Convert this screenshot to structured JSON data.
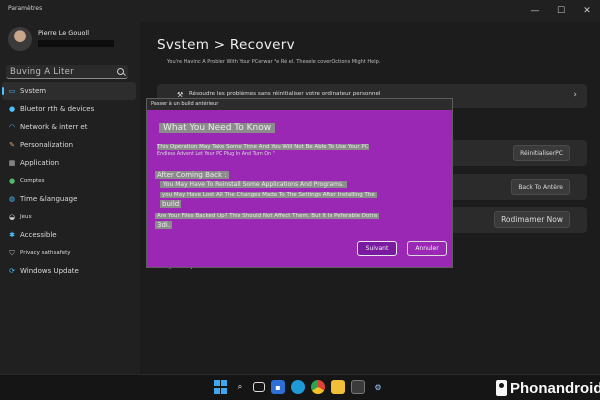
{
  "window": {
    "title": "Paramètres",
    "controls": [
      "—",
      "☐",
      "✕"
    ]
  },
  "profile": {
    "name": "Pierre Le Gouoll"
  },
  "search": {
    "placeholder": "Buving A Liter"
  },
  "sidebar": {
    "items": [
      {
        "label": "Svstem",
        "icon": "monitor-icon",
        "active": true
      },
      {
        "label": "Bluetor  rth & devices",
        "icon": "bluetooth-icon"
      },
      {
        "label": "Network & interr et",
        "icon": "wifi-icon"
      },
      {
        "label": "Personalization",
        "icon": "brush-icon"
      },
      {
        "label": "Application",
        "icon": "apps-icon"
      },
      {
        "label": "Comptes",
        "icon": "person-icon"
      },
      {
        "label": "Time &language",
        "icon": "globe-icon"
      },
      {
        "label": "Jeux",
        "icon": "gamepad-icon"
      },
      {
        "label": "Accessible",
        "icon": "accessibility-icon"
      },
      {
        "label": "Privacy   sathsafety",
        "icon": "shield-icon"
      },
      {
        "label": "Windows Update",
        "icon": "update-icon"
      }
    ]
  },
  "main": {
    "title": "Svstem > Recoverv",
    "subtitle": "You're Havinc A Probler With Your PCerwar ³e Ré el. Thesele coverOctions Might Help.",
    "troubleshoot": {
      "label": "Résoudre les problèmes sans réinitialiser votre ordinateur personnel",
      "icon": "wrench-icon"
    },
    "reset_button": "RéinitialiserPC",
    "back_button": "Back To Antère",
    "advanced_button": "Rodimamer Now",
    "feedback": "Envoyer des commentaires"
  },
  "dialog": {
    "title": "Passer à un build antérieur",
    "heading": "What You Need To Know",
    "line1": "This Operation May Take Some Time And You Will Not Be Able To Use Your PC",
    "line1b": "Endless Advent Let Your PC Plug In And Turn On \"",
    "heading2": "After Coming Back :",
    "item1": "You May Have To Reinstall Some Applications And Programs.",
    "item2": "you May Have Lost All The Changes Made To The Settings After Installing The",
    "item3": "build",
    "question1": "Are Your Files Backed Up? This Should Not Affect Them. But It Is Peferable Dotra",
    "question2": "3di.",
    "next_label": "Suivant",
    "cancel_label": "Annuler"
  },
  "taskbar": {
    "icons": [
      "windows-start-icon",
      "search-icon",
      "task-view-icon",
      "widgets-icon",
      "edge-icon",
      "chrome-icon",
      "file-explorer-icon",
      "store-icon",
      "settings-icon"
    ]
  },
  "brand": {
    "text": "Phonandroid"
  },
  "colors": {
    "dialog_bg": "#9b27b5",
    "accent": "#4cc2ff",
    "background": "#1c1c1c"
  }
}
